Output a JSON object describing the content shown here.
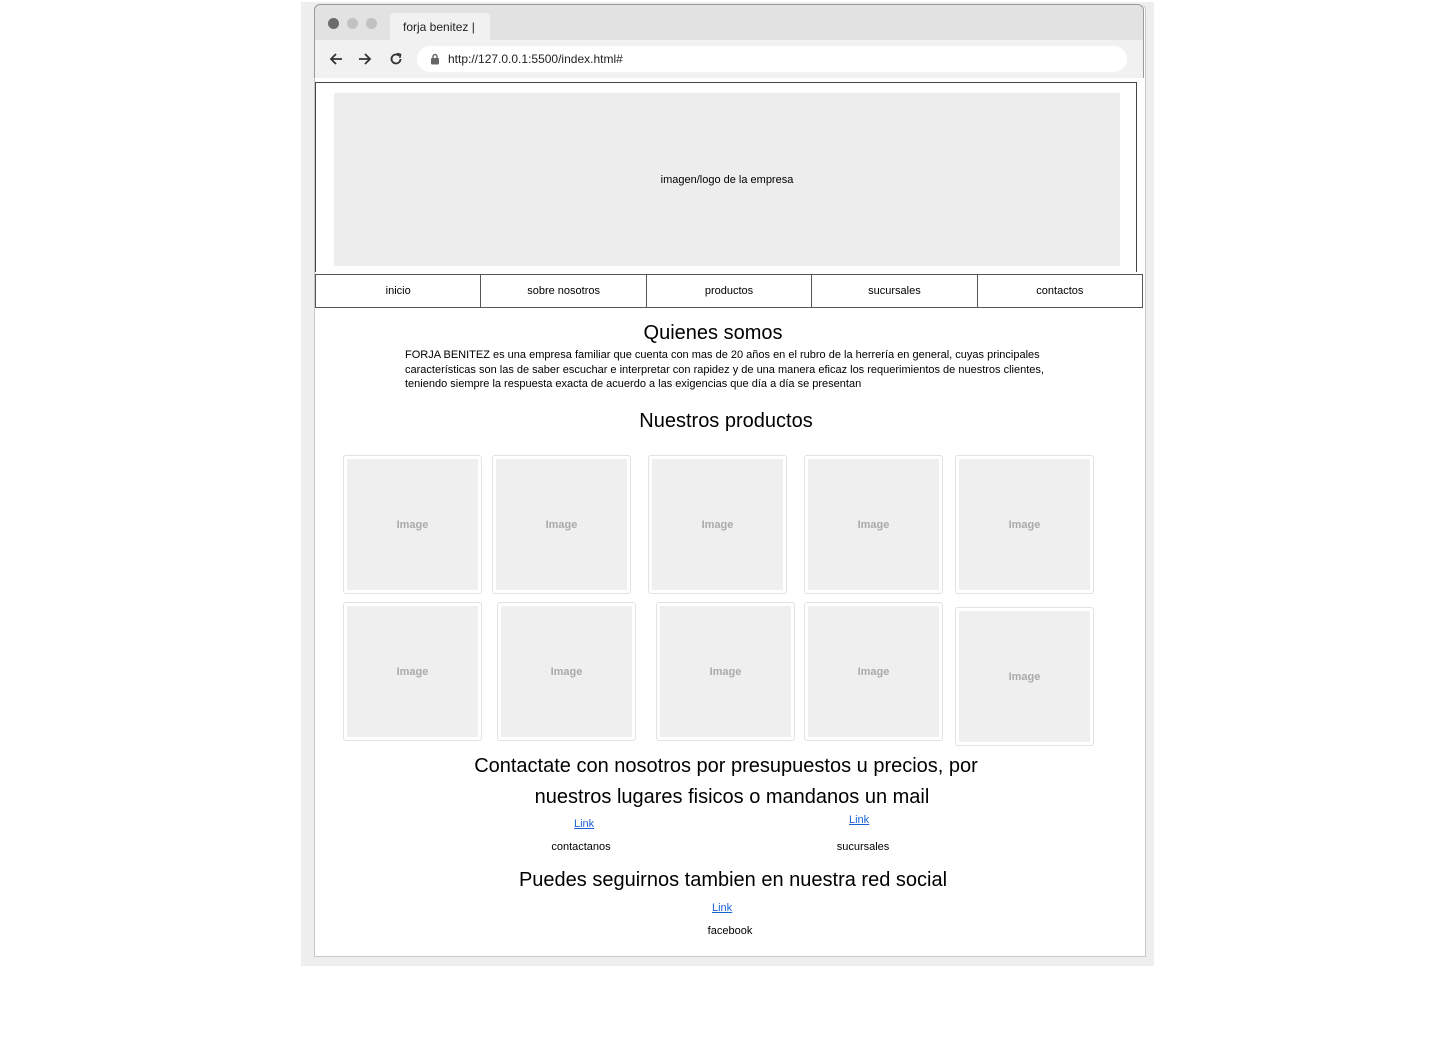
{
  "browser": {
    "tab_title": "forja benitez |",
    "url": "http://127.0.0.1:5500/index.html#",
    "dot_colors": [
      "#6b6b6b",
      "#c2c2c2",
      "#c2c2c2"
    ]
  },
  "header": {
    "logo_text": "imagen/logo de la empresa"
  },
  "nav": {
    "items": [
      "inicio",
      "sobre nosotros",
      "productos",
      "sucursales",
      "contactos"
    ]
  },
  "about": {
    "title": "Quienes somos",
    "text": "FORJA BENITEZ es una empresa familiar que cuenta con mas de 20 años en el rubro de la herrería en general, cuyas principales características son las de saber escuchar e interpretar con rapidez y de una manera eficaz los requerimientos de nuestros clientes, teniendo siempre la respuesta exacta de acuerdo a las exigencias que día a día se presentan"
  },
  "products": {
    "title": "Nuestros productos",
    "items": [
      "Image",
      "Image",
      "Image",
      "Image",
      "Image",
      "Image",
      "Image",
      "Image",
      "Image",
      "Image"
    ]
  },
  "contact": {
    "title_line1": "Contactate con nosotros por presupuestos u precios, por",
    "title_line2": "nuestros lugares fisicos o mandanos un mail",
    "links": [
      {
        "link": "Link",
        "label": "contactanos"
      },
      {
        "link": "Link",
        "label": "sucursales"
      }
    ]
  },
  "social": {
    "title": "Puedes seguirnos tambien en nuestra red social",
    "link": "Link",
    "label": "facebook"
  }
}
